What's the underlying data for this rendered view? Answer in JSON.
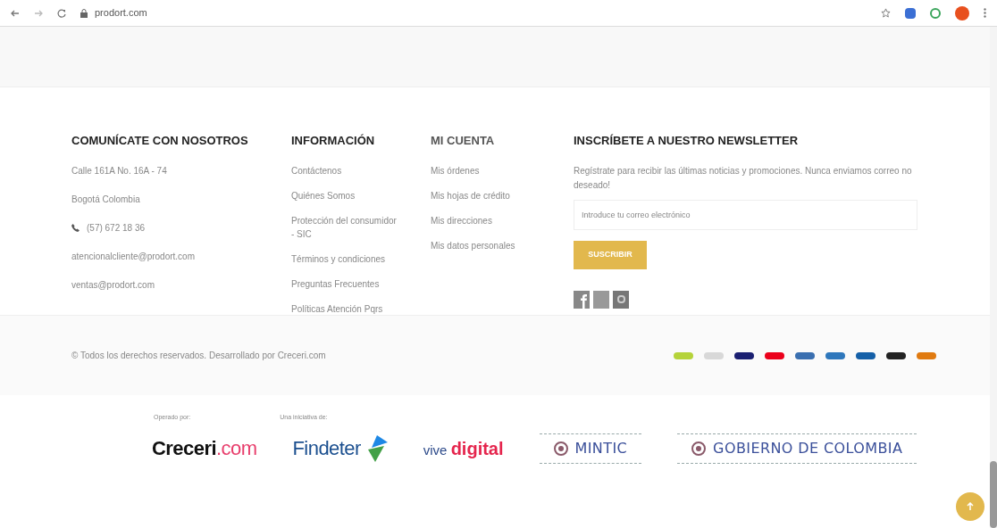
{
  "browser": {
    "url": "prodort.com"
  },
  "contact": {
    "title": "COMUNÍCATE CON NOSOTROS",
    "lines": [
      {
        "kind": "text",
        "text": "Calle 161A No. 16A - 74"
      },
      {
        "kind": "text",
        "text": "Bogotá Colombia"
      },
      {
        "kind": "phone",
        "text": "(57) 672 18 36"
      },
      {
        "kind": "link",
        "text": "atencionalcliente@prodort.com"
      },
      {
        "kind": "link",
        "text": "ventas@prodort.com"
      }
    ]
  },
  "info": {
    "title": "INFORMACIÓN",
    "links": [
      "Contáctenos",
      "Quiénes Somos",
      "Protección del consumidor - SIC",
      "Términos y condiciones",
      "Preguntas Frecuentes",
      "Políticas Atención Pqrs"
    ]
  },
  "account": {
    "title": "MI CUENTA",
    "links": [
      "Mis órdenes",
      "Mis hojas de crédito",
      "Mis direcciones",
      "Mis datos personales"
    ]
  },
  "newsletter": {
    "title": "INSCRÍBETE A NUESTRO NEWSLETTER",
    "text": "Regístrate para recibir las últimas noticias y promociones. Nunca enviamos correo no deseado!",
    "placeholder": "Introduce tu correo electrónico",
    "button": "SUSCRIBIR"
  },
  "copyright": "© Todos los derechos reservados. Desarrollado por Creceri.com",
  "operated_label": "Operado por:",
  "initiative_label": "Una iniciativa de:",
  "logos": [
    {
      "kind": "creceri",
      "text": "Creceri",
      "suffix": ".com"
    },
    {
      "kind": "findeter",
      "text": "Findeter"
    },
    {
      "kind": "vive",
      "text": "vive",
      "suffix": "digital"
    },
    {
      "kind": "gov",
      "text": "MINTIC"
    },
    {
      "kind": "gov",
      "text": "GOBIERNO DE COLOMBIA"
    }
  ]
}
